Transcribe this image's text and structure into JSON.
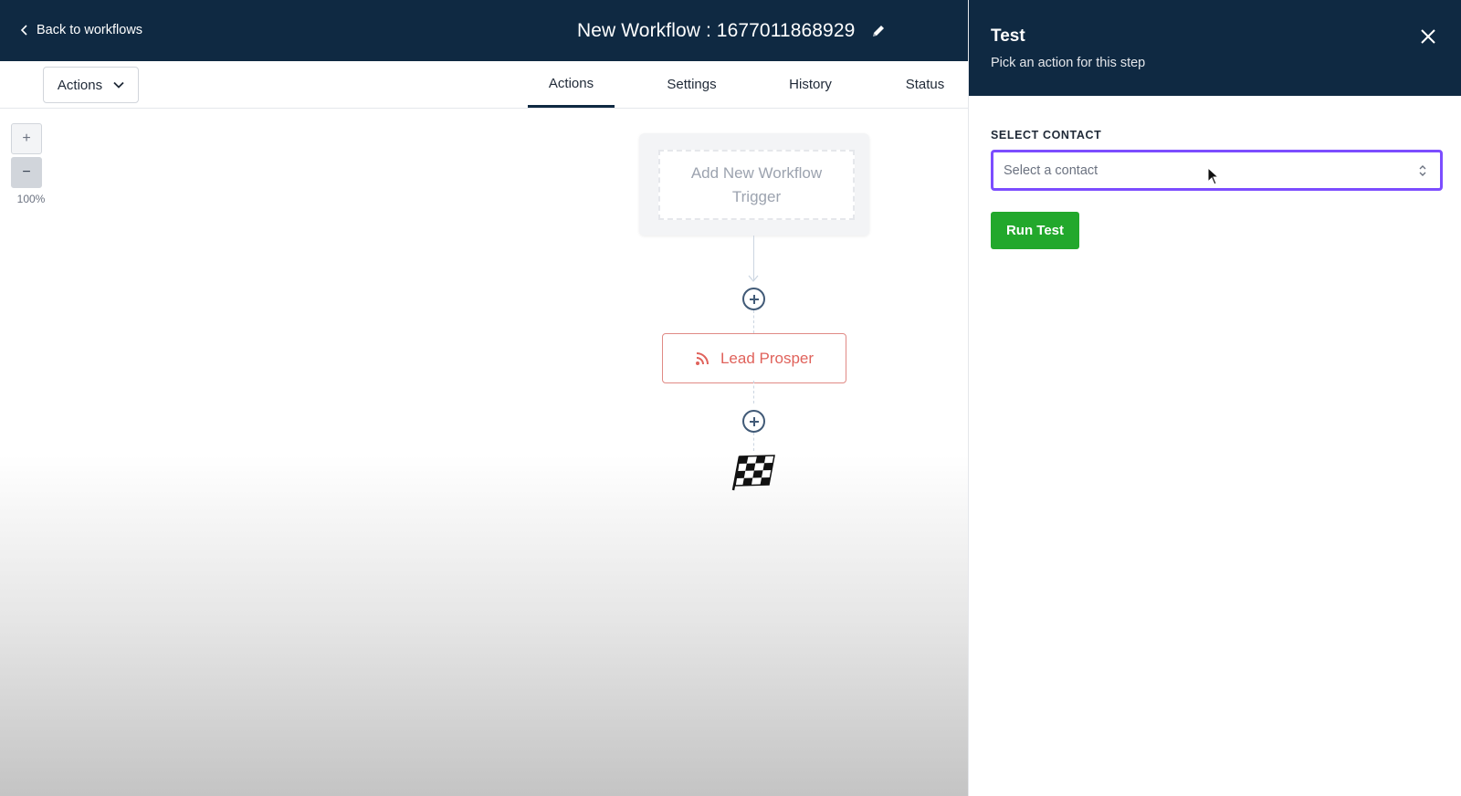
{
  "header": {
    "back_label": "Back to workflows",
    "workflow_title": "New Workflow : 1677011868929"
  },
  "toolbar": {
    "actions_dropdown_label": "Actions",
    "tabs": [
      {
        "label": "Actions",
        "active": true
      },
      {
        "label": "Settings",
        "active": false
      },
      {
        "label": "History",
        "active": false
      },
      {
        "label": "Status",
        "active": false
      }
    ]
  },
  "canvas": {
    "zoom_in_symbol": "+",
    "zoom_out_symbol": "−",
    "zoom_level": "100%",
    "trigger_placeholder": "Add New Workflow Trigger",
    "action_node": {
      "label": "Lead Prosper",
      "icon": "rss-icon",
      "color": "#e0625b"
    },
    "end_marker_icon": "finish-flag-icon"
  },
  "panel": {
    "title": "Test",
    "subtitle": "Pick an action for this step",
    "contact_label": "SELECT CONTACT",
    "contact_placeholder": "Select a contact",
    "run_button": "Run Test"
  },
  "colors": {
    "header_bg": "#0f2942",
    "select_focus": "#7c4dff",
    "run_button": "#22a82c",
    "action_node": "#e0625b"
  }
}
